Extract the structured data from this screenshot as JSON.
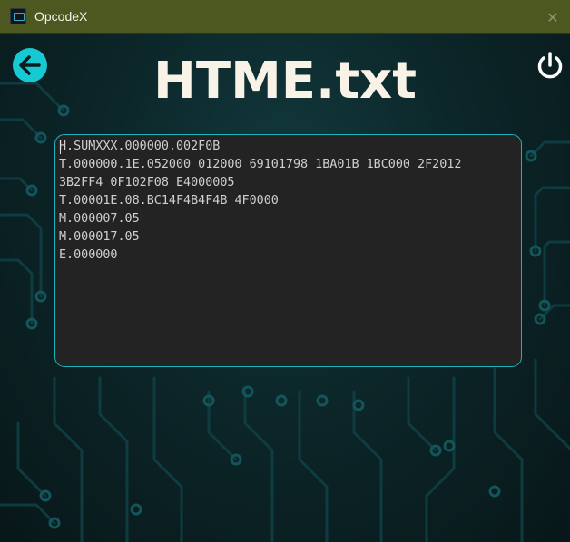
{
  "window": {
    "title": "OpcodeX",
    "close_glyph": "✕"
  },
  "page": {
    "title": "HTME.txt"
  },
  "icons": {
    "back": "arrow-left-icon",
    "power": "power-icon",
    "close": "close-icon",
    "app": "app-icon"
  },
  "editor": {
    "lines": [
      "H.SUMXXX.000000.002F0B",
      "T.000000.1E.052000 012000 69101798 1BA01B 1BC000 2F2012",
      "3B2FF4 0F102F08 E4000005",
      "T.00001E.08.BC14F4B4F4B 4F0000",
      "M.000007.05",
      "M.000017.05",
      "E.000000"
    ]
  },
  "colors": {
    "titlebar": "#4c5820",
    "accent": "#17c9d3",
    "background": "#0c2629",
    "editor_bg": "#232323",
    "text": "#cfcfcf",
    "title_text": "#f8f3e6"
  }
}
